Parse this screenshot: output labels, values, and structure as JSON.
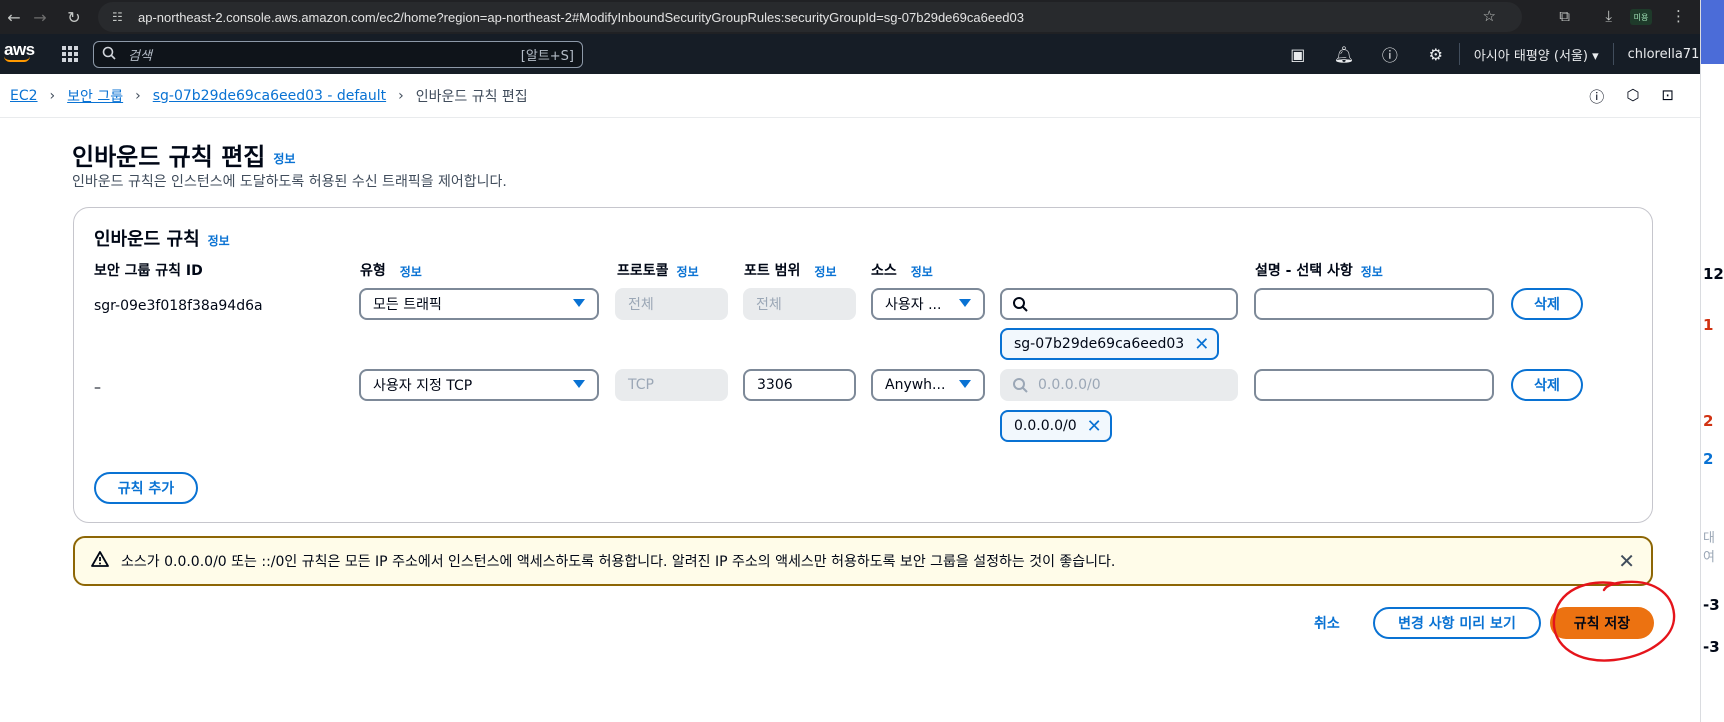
{
  "browser": {
    "url": "ap-northeast-2.console.aws.amazon.com/ec2/home?region=ap-northeast-2#ModifyInboundSecurityGroupRules:securityGroupId=sg-07b29de69ca6eed03",
    "profile_badge": "미용"
  },
  "topnav": {
    "logo": "aws",
    "search_placeholder": "검색",
    "search_shortcut": "[알트+S]",
    "region": "아시아 태평양 (서울) ▾",
    "user": "chlorella71 ▾"
  },
  "breadcrumb": {
    "items": [
      "EC2",
      "보안 그룹",
      "sg-07b29de69ca6eed03 - default"
    ],
    "current": "인바운드 규칙 편집"
  },
  "page": {
    "title": "인바운드 규칙 편집",
    "info": "정보",
    "description": "인바운드 규칙은 인스턴스에 도달하도록 허용된 수신 트래픽을 제어합니다."
  },
  "panel": {
    "title": "인바운드 규칙",
    "info": "정보",
    "columns": {
      "rule_id": "보안 그룹 규칙 ID",
      "type": "유형",
      "protocol": "프로토콜",
      "port_range": "포트 범위",
      "source": "소스",
      "description": "설명 - 선택 사항",
      "info": "정보"
    },
    "rules": [
      {
        "rule_id": "sgr-09e3f018f38a94d6a",
        "type": "모든 트래픽",
        "protocol": "전체",
        "port_range": "전체",
        "source_type": "사용자 ...",
        "source_search": "",
        "source_token": "sg-07b29de69ca6eed03",
        "description": "",
        "delete_label": "삭제"
      },
      {
        "rule_id": "–",
        "type": "사용자 지정 TCP",
        "protocol": "TCP",
        "port_range": "3306",
        "source_type": "Anywh...",
        "source_search": "0.0.0.0/0",
        "source_token": "0.0.0.0/0",
        "description": "",
        "delete_label": "삭제"
      }
    ],
    "add_rule_label": "규칙 추가"
  },
  "alert": {
    "message": "소스가 0.0.0.0/0 또는 ::/0인 규칙은 모든 IP 주소에서 인스턴스에 액세스하도록 허용합니다. 알려진 IP 주소의 액세스만 허용하도록 보안 그룹을 설정하는 것이 좋습니다."
  },
  "footer": {
    "cancel_label": "취소",
    "preview_label": "변경 사항 미리 보기",
    "save_label": "규칙 저장"
  },
  "side_strip": {
    "texts": [
      "12",
      "1",
      "2",
      "2",
      "대여",
      "-3",
      "-3"
    ]
  }
}
